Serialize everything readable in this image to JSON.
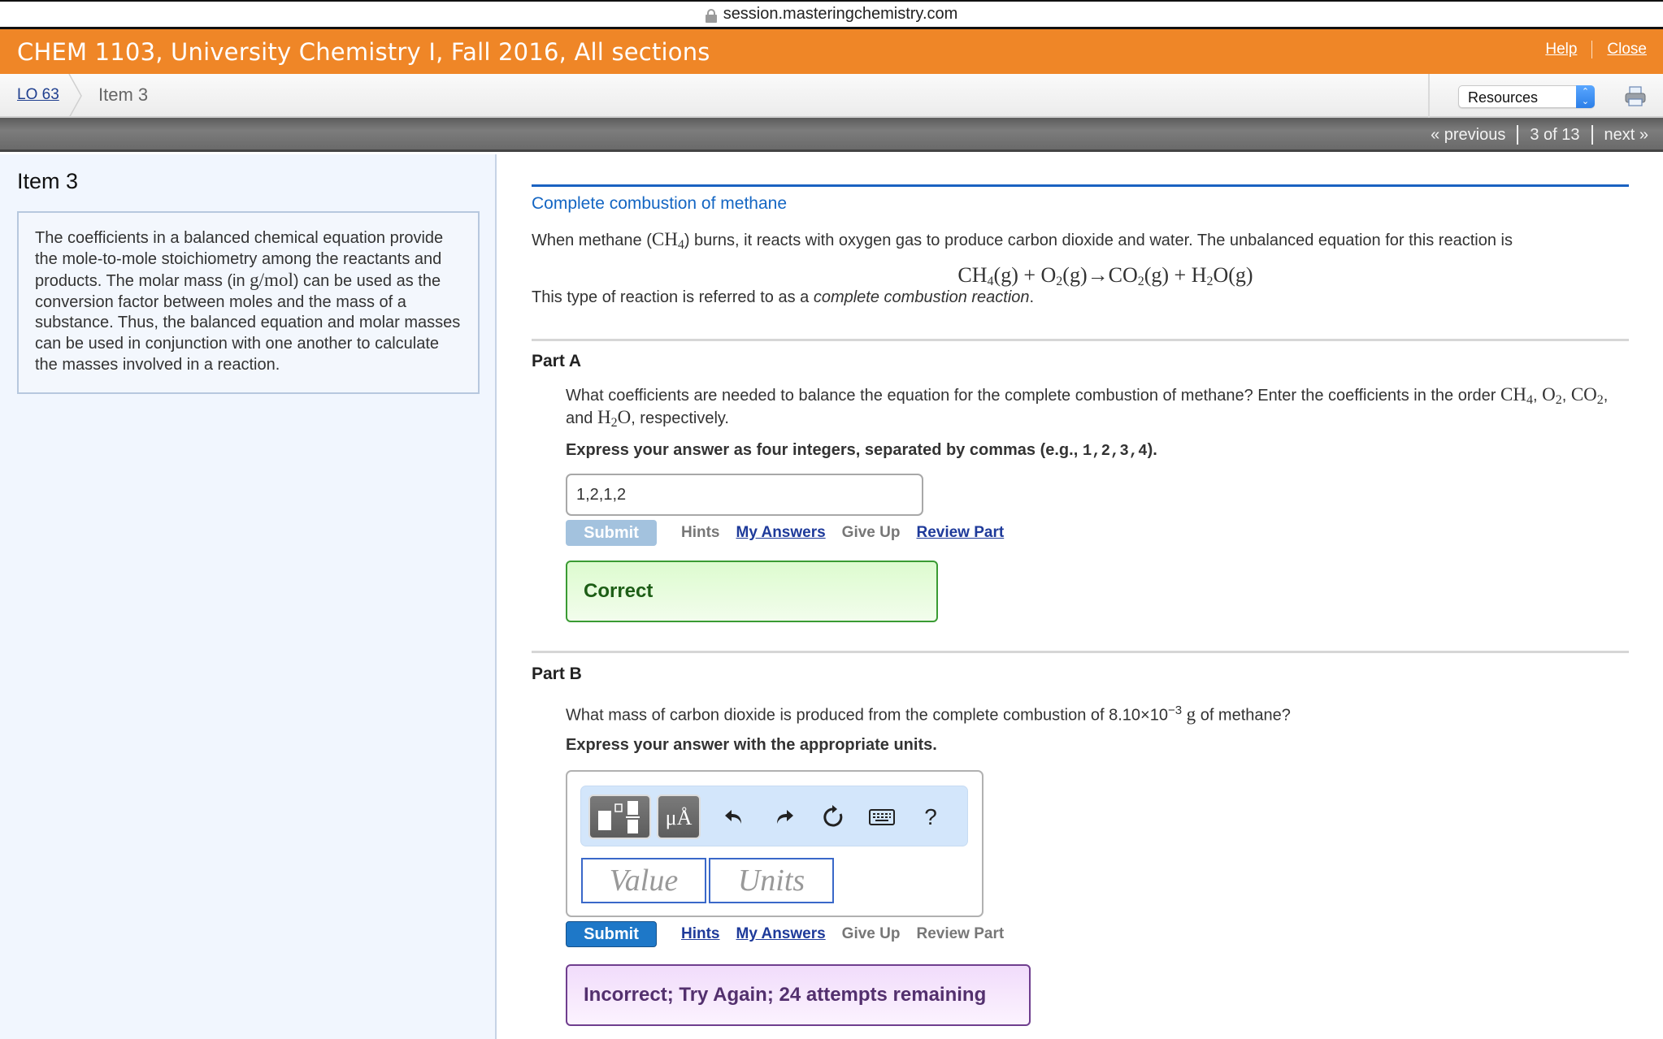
{
  "browser": {
    "url": "session.masteringchemistry.com"
  },
  "header": {
    "course_title": "CHEM 1103, University Chemistry I, Fall 2016, All sections",
    "help_label": "Help",
    "close_label": "Close",
    "brand_color": "#ef8627"
  },
  "breadcrumb": {
    "parent": "LO 63",
    "current": "Item 3"
  },
  "resources_select": {
    "selected": "Resources"
  },
  "pagination": {
    "previous_label": "« previous",
    "position": "3 of 13",
    "next_label": "next »"
  },
  "left_panel": {
    "title": "Item 3",
    "intro_before": "The coefficients in a balanced chemical equation provide the mole-to-mole stoichiometry among the reactants and products. The molar mass (in ",
    "intro_unit": "g/mol",
    "intro_after": ") can be used as the conversion factor between moles and the mass of a substance.  Thus, the balanced equation and molar masses can be used in conjunction with one another to calculate the masses involved in a reaction."
  },
  "intro": {
    "title": "Complete combustion of methane",
    "text_before": "When methane (",
    "text_formula": "CH",
    "text_formula_sub": "4",
    "text_after": ") burns, it reacts with oxygen gas to produce carbon dioxide and water. The unbalanced equation for this reaction is",
    "equation": {
      "t1": "CH",
      "s1": "4",
      "t2": "(g) + O",
      "s2": "2",
      "t3": "(g)→CO",
      "s3": "2",
      "t4": "(g) + H",
      "s4": "2",
      "t5": "O(g)"
    },
    "text2_before": "This type of reaction is referred to as a ",
    "text2_italic": "complete combustion reaction",
    "text2_after": "."
  },
  "part_a": {
    "title": "Part A",
    "question_1": "What coefficients are needed to balance the equation for the complete combustion of methane? Enter the coefficients in the order ",
    "f1": "CH",
    "f1s": "4",
    "f2": "O",
    "f2s": "2",
    "f3": "CO",
    "f3s": "2",
    "f4": "H",
    "f4s": "2",
    "f4b": "O",
    "and_label": ", and ",
    "question_end": ", respectively.",
    "instruction_before": "Express your answer as four integers, separated by commas (e.g., ",
    "instruction_example": "1,2,3,4",
    "instruction_after": ").",
    "answer_value": "1,2,1,2",
    "submit_label": "Submit",
    "hints_label": "Hints",
    "my_answers_label": "My Answers",
    "give_up_label": "Give Up",
    "review_part_label": "Review Part",
    "feedback": "Correct",
    "feedback_color": "#1d5e16"
  },
  "part_b": {
    "title": "Part B",
    "question_before": "What mass of carbon dioxide is produced from the complete combustion of 8.10×10",
    "question_exp": "−3",
    "question_unit": "g",
    "question_after": " of methane?",
    "instruction": "Express your answer with the appropriate units.",
    "toolbar": {
      "units_label": "μÅ",
      "help_label": "?"
    },
    "value_placeholder": "Value",
    "units_placeholder": "Units",
    "submit_label": "Submit",
    "hints_label": "Hints",
    "my_answers_label": "My Answers",
    "give_up_label": "Give Up",
    "review_part_label": "Review Part",
    "feedback": "Incorrect; Try Again; 24 attempts remaining",
    "feedback_color": "#53306e"
  }
}
